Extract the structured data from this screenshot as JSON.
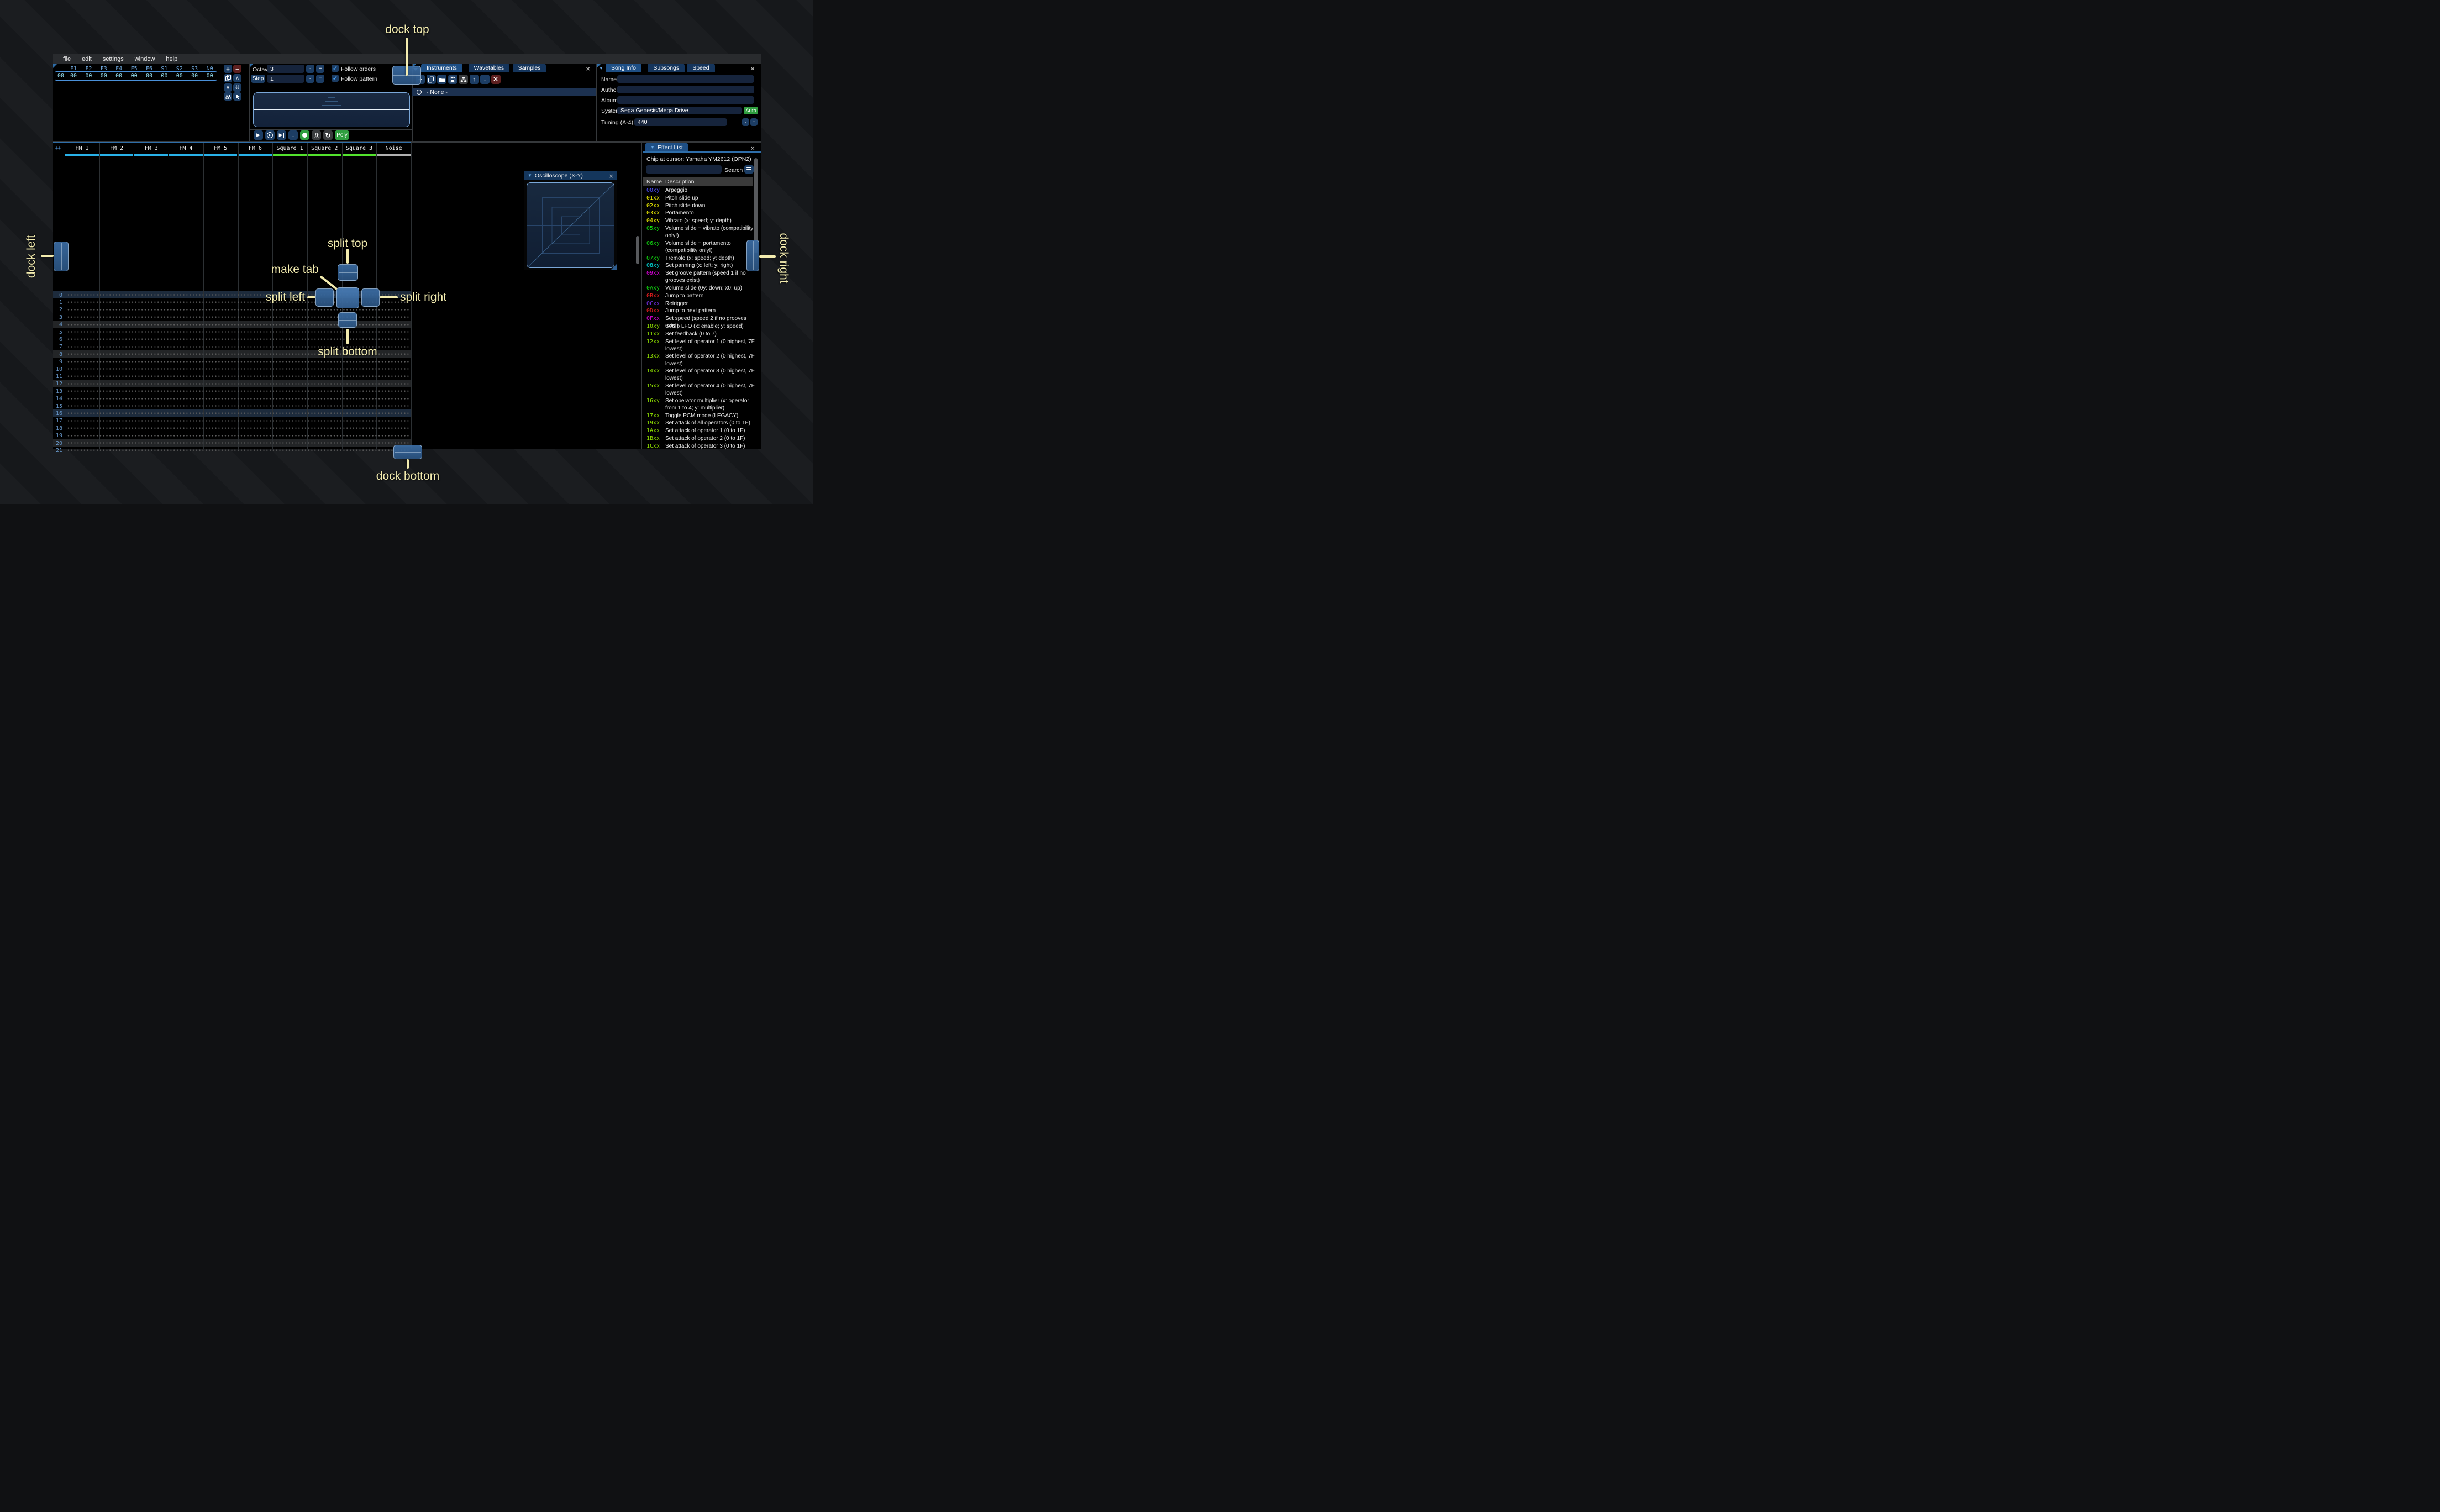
{
  "annotations": {
    "color": "#f3ecaf",
    "dock_top": "dock top",
    "dock_bottom": "dock bottom",
    "dock_left": "dock left",
    "dock_right": "dock right",
    "split_top": "split top",
    "split_bottom": "split bottom",
    "split_left": "split left",
    "split_right": "split right",
    "make_tab": "make tab"
  },
  "menu": {
    "items": [
      "file",
      "edit",
      "settings",
      "window",
      "help"
    ]
  },
  "orders": {
    "columns": [
      "F1",
      "F2",
      "F3",
      "F4",
      "F5",
      "F6",
      "S1",
      "S2",
      "S3",
      "N0"
    ],
    "row_index": "00",
    "row_values": [
      "00",
      "00",
      "00",
      "00",
      "00",
      "00",
      "00",
      "00",
      "00",
      "00"
    ],
    "buttons": [
      {
        "icon": "plus",
        "style": "blue",
        "name": "add-order"
      },
      {
        "icon": "minus",
        "style": "red",
        "name": "remove-order"
      },
      {
        "icon": "copy",
        "style": "blue",
        "name": "duplicate-order"
      },
      {
        "icon": "chevron-up",
        "style": "blue",
        "name": "move-order-up"
      },
      {
        "icon": "chevron-down",
        "style": "blue",
        "name": "move-order-down"
      },
      {
        "icon": "double-down",
        "style": "blue",
        "name": "duplicate-order-end"
      },
      {
        "icon": "chain-broken",
        "style": "blue",
        "name": "deep-clone-order"
      },
      {
        "icon": "cursor",
        "style": "blue",
        "name": "order-change-mode"
      }
    ]
  },
  "controls": {
    "octave_label": "Octave",
    "octave_value": "3",
    "step_label": "Step",
    "step_value": "1",
    "minus": "-",
    "plus": "+",
    "follow_orders": "Follow orders",
    "follow_pattern": "Follow pattern",
    "check": "✓",
    "transport": [
      {
        "icon": "play",
        "style": "blue",
        "name": "play"
      },
      {
        "icon": "play-circle",
        "style": "blue",
        "name": "play-pattern"
      },
      {
        "icon": "play-bar",
        "style": "blue",
        "name": "play-from-cursor"
      },
      {
        "icon": "arrow-down",
        "style": "blue",
        "name": "step-one-row"
      },
      {
        "icon": "record",
        "style": "green",
        "name": "edit-record"
      },
      {
        "icon": "metronome",
        "style": "gray",
        "name": "metronome"
      },
      {
        "icon": "repeat",
        "style": "gray",
        "name": "repeat-pattern"
      }
    ],
    "poly_label": "Poly"
  },
  "instruments_panel": {
    "tabs": [
      "Instruments",
      "Wavetables",
      "Samples"
    ],
    "active_tab": "Instruments",
    "close": "×",
    "toolbar": [
      {
        "icon": "plus",
        "style": "blue",
        "name": "add-instrument"
      },
      {
        "icon": "copy",
        "style": "blue",
        "name": "duplicate-instrument"
      },
      {
        "icon": "folder-open",
        "style": "blue",
        "name": "open-instrument"
      },
      {
        "icon": "save",
        "style": "blue",
        "name": "save-instrument"
      },
      {
        "icon": "tree",
        "style": "gray",
        "name": "instrument-dir"
      },
      {
        "icon": "arrow-up",
        "style": "blue",
        "name": "move-instrument-up"
      },
      {
        "icon": "arrow-down-thick",
        "style": "blue",
        "name": "move-instrument-down"
      },
      {
        "icon": "delete-x",
        "style": "red",
        "name": "delete-instrument"
      }
    ],
    "selected_item": "- None -"
  },
  "song_info": {
    "tabs": [
      "Song Info",
      "Subsongs",
      "Speed"
    ],
    "active_tab": "Song Info",
    "close": "×",
    "name_label": "Name",
    "name_value": "",
    "author_label": "Author",
    "author_value": "",
    "album_label": "Album",
    "album_value": "",
    "system_label": "System",
    "system_value": "Sega Genesis/Mega Drive",
    "auto_label": "Auto",
    "tuning_label": "Tuning (A-4)",
    "tuning_value": "440",
    "auto_color": "#2f9e3f"
  },
  "pattern": {
    "corner": "++",
    "channels": [
      {
        "name": "FM 1",
        "color": "#29b1e8"
      },
      {
        "name": "FM 2",
        "color": "#29b1e8"
      },
      {
        "name": "FM 3",
        "color": "#29b1e8"
      },
      {
        "name": "FM 4",
        "color": "#29b1e8"
      },
      {
        "name": "FM 5",
        "color": "#29b1e8"
      },
      {
        "name": "FM 6",
        "color": "#29b1e8"
      },
      {
        "name": "Square 1",
        "color": "#53e22d"
      },
      {
        "name": "Square 2",
        "color": "#53e22d"
      },
      {
        "name": "Square 3",
        "color": "#53e22d"
      },
      {
        "name": "Noise",
        "color": "#b0b0b0"
      }
    ],
    "rows": [
      0,
      1,
      2,
      3,
      4,
      5,
      6,
      7,
      8,
      9,
      10,
      11,
      12,
      13,
      14,
      15,
      16,
      17,
      18,
      19,
      20,
      21
    ],
    "highlight_major_rows": [
      0,
      16
    ],
    "highlight_minor_rows": [
      4,
      8,
      12,
      20
    ],
    "highlight_major_color": "#1d2b3c",
    "highlight_minor_color": "#232527"
  },
  "effect_list": {
    "title": "Effect List",
    "close": "×",
    "chip_line": "Chip at cursor: Yamaha YM2612 (OPN2)",
    "search_value": "",
    "search_label": "Search",
    "header_name": "Name",
    "header_desc": "Description",
    "palette": {
      "blue": "#5050ff",
      "yellow": "#f0f000",
      "green": "#10e010",
      "cyan": "#00e0e0",
      "magenta": "#e000e0",
      "red": "#f02020",
      "violet": "#7a30f0",
      "chartreuse": "#8fe000"
    },
    "rows": [
      {
        "code": "00xy",
        "color": "blue",
        "desc": "Arpeggio"
      },
      {
        "code": "01xx",
        "color": "yellow",
        "desc": "Pitch slide up"
      },
      {
        "code": "02xx",
        "color": "yellow",
        "desc": "Pitch slide down"
      },
      {
        "code": "03xx",
        "color": "yellow",
        "desc": "Portamento"
      },
      {
        "code": "04xy",
        "color": "yellow",
        "desc": "Vibrato (x: speed; y: depth)"
      },
      {
        "code": "05xy",
        "color": "green",
        "desc": "Volume slide + vibrato (compatibility\nonly!)"
      },
      {
        "code": "06xy",
        "color": "green",
        "desc": "Volume slide + portamento\n(compatibility only!)"
      },
      {
        "code": "07xy",
        "color": "green",
        "desc": "Tremolo (x: speed; y: depth)"
      },
      {
        "code": "08xy",
        "color": "cyan",
        "desc": "Set panning (x: left; y: right)"
      },
      {
        "code": "09xx",
        "color": "magenta",
        "desc": "Set groove pattern (speed 1 if no\ngrooves exist)"
      },
      {
        "code": "0Axy",
        "color": "green",
        "desc": "Volume slide (0y: down; x0: up)"
      },
      {
        "code": "0Bxx",
        "color": "red",
        "desc": "Jump to pattern"
      },
      {
        "code": "0Cxx",
        "color": "violet",
        "desc": "Retrigger"
      },
      {
        "code": "0Dxx",
        "color": "red",
        "desc": "Jump to next pattern"
      },
      {
        "code": "0Fxx",
        "color": "magenta",
        "desc": "Set speed (speed 2 if no grooves exist)"
      },
      {
        "code": "10xy",
        "color": "chartreuse",
        "desc": "Setup LFO (x: enable; y: speed)"
      },
      {
        "code": "11xx",
        "color": "chartreuse",
        "desc": "Set feedback (0 to 7)"
      },
      {
        "code": "12xx",
        "color": "chartreuse",
        "desc": "Set level of operator 1 (0 highest, 7F\nlowest)"
      },
      {
        "code": "13xx",
        "color": "chartreuse",
        "desc": "Set level of operator 2 (0 highest, 7F\nlowest)"
      },
      {
        "code": "14xx",
        "color": "chartreuse",
        "desc": "Set level of operator 3 (0 highest, 7F\nlowest)"
      },
      {
        "code": "15xx",
        "color": "chartreuse",
        "desc": "Set level of operator 4 (0 highest, 7F\nlowest)"
      },
      {
        "code": "16xy",
        "color": "chartreuse",
        "desc": "Set operator multiplier (x: operator\nfrom 1 to 4; y: multiplier)"
      },
      {
        "code": "17xx",
        "color": "chartreuse",
        "desc": "Toggle PCM mode (LEGACY)"
      },
      {
        "code": "19xx",
        "color": "chartreuse",
        "desc": "Set attack of all operators (0 to 1F)"
      },
      {
        "code": "1Axx",
        "color": "chartreuse",
        "desc": "Set attack of operator 1 (0 to 1F)"
      },
      {
        "code": "1Bxx",
        "color": "chartreuse",
        "desc": "Set attack of operator 2 (0 to 1F)"
      },
      {
        "code": "1Cxx",
        "color": "chartreuse",
        "desc": "Set attack of operator 3 (0 to 1F)"
      }
    ]
  },
  "oscilloscope_xy": {
    "title": "Oscilloscope (X-Y)",
    "close": "×"
  }
}
